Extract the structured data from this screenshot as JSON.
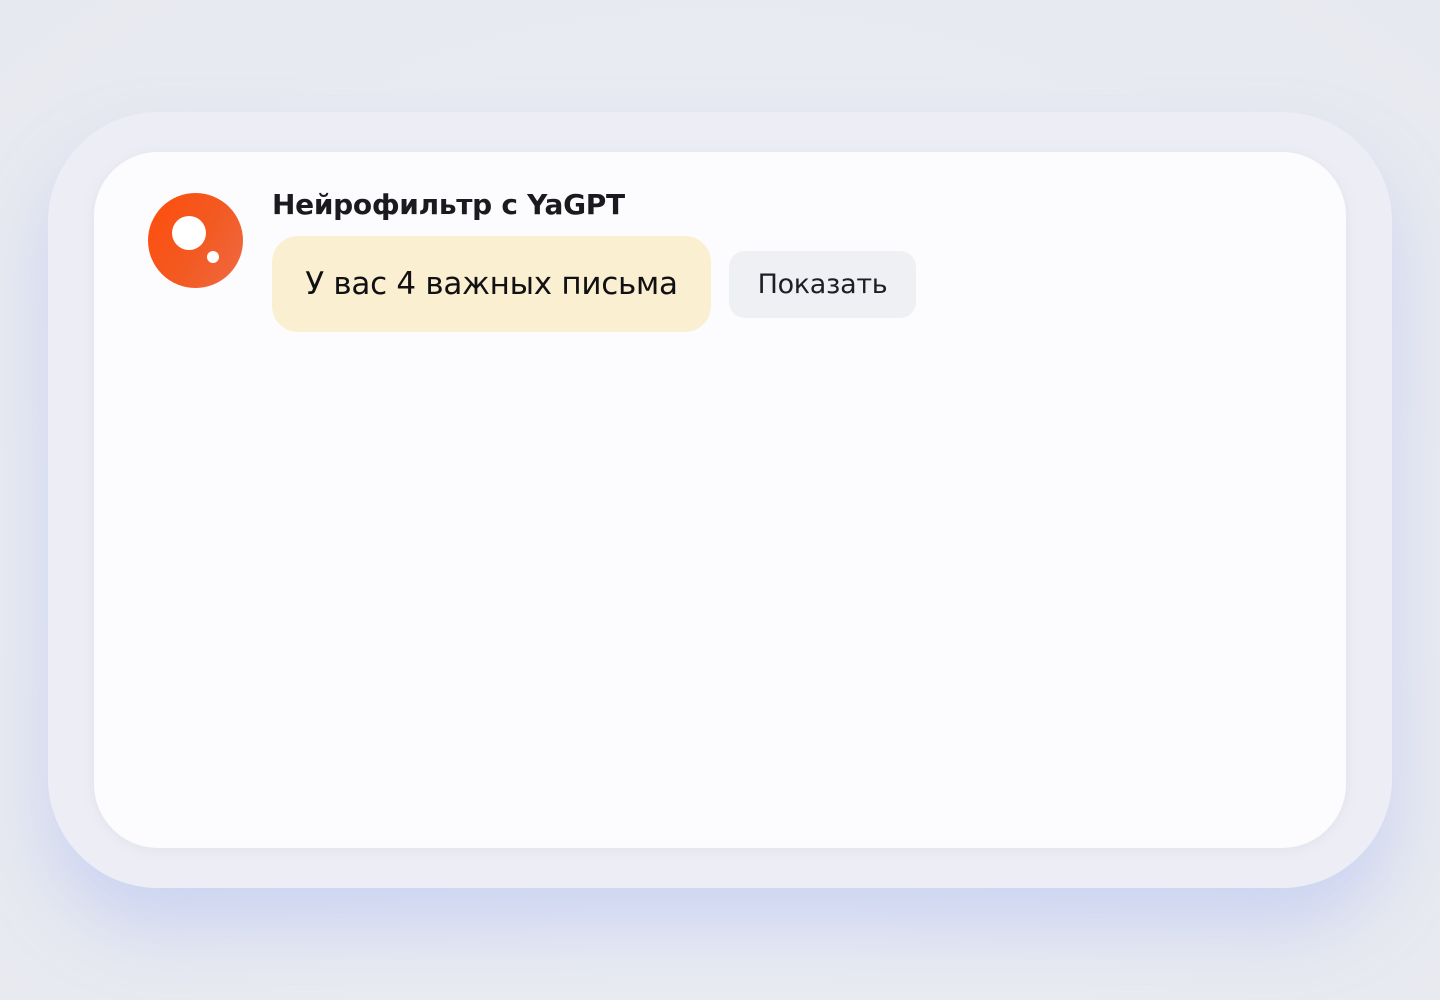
{
  "notification": {
    "sender": "Нейрофильтр с YaGPT",
    "message": "У вас 4 важных письма",
    "action_label": "Показать",
    "avatar_icon": "neurofilter-logo-icon"
  },
  "colors": {
    "brand_orange": "#ff4d0d",
    "message_bubble": "#fbefd2",
    "button_bg": "#eff0f4",
    "card_bg": "#fcfcfe",
    "page_bg": "#e9ebf2"
  }
}
